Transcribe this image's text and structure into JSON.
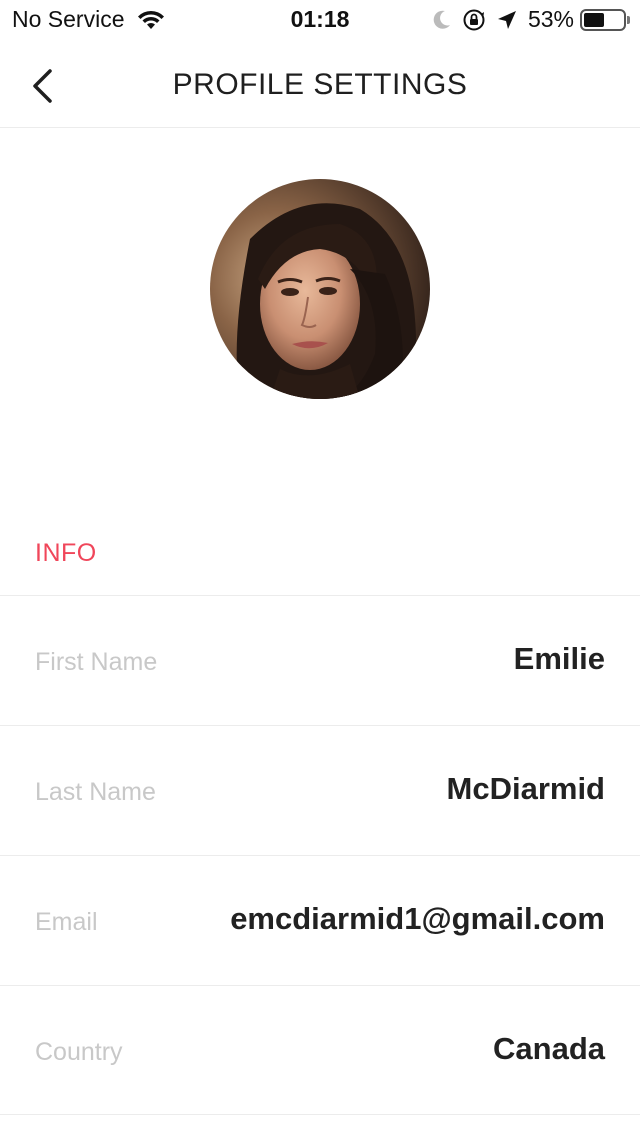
{
  "status_bar": {
    "carrier": "No Service",
    "time": "01:18",
    "battery_percent": "53%",
    "battery_level": 0.53,
    "icons": [
      "wifi-icon",
      "moon-icon",
      "rotation-lock-icon",
      "location-arrow-icon",
      "battery-icon"
    ]
  },
  "nav": {
    "title": "PROFILE SETTINGS",
    "back_icon": "chevron-left-icon"
  },
  "profile": {
    "avatar": "profile-photo"
  },
  "info": {
    "section_label": "INFO",
    "rows": [
      {
        "label": "First Name",
        "value": "Emilie"
      },
      {
        "label": "Last Name",
        "value": "McDiarmid"
      },
      {
        "label": "Email",
        "value": "emcdiarmid1@gmail.com"
      },
      {
        "label": "Country",
        "value": "Canada"
      }
    ]
  },
  "colors": {
    "accent": "#f0465a",
    "label_gray": "#c8c8c8",
    "divider": "#ececec"
  }
}
